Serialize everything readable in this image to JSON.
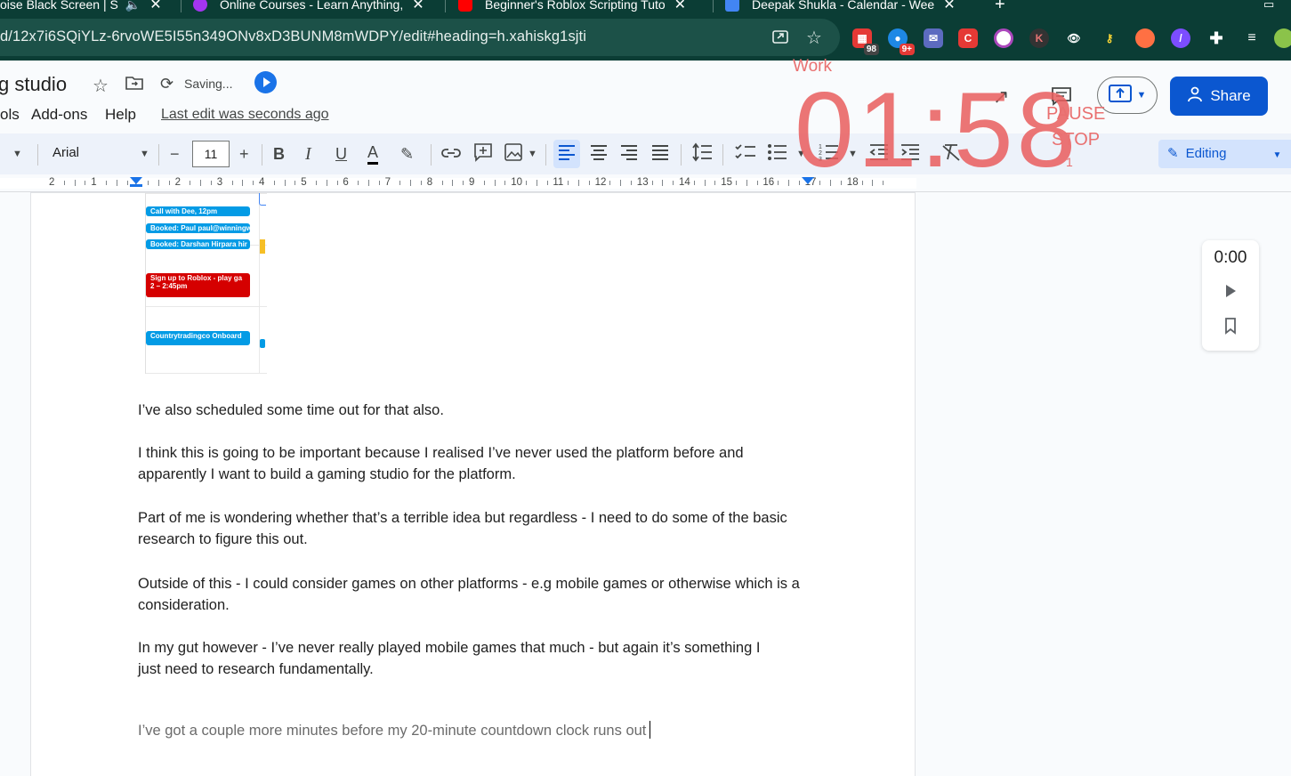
{
  "tabs": [
    {
      "title": "oise Black Screen | S"
    },
    {
      "title": "Online Courses - Learn Anything,"
    },
    {
      "title": "Beginner's Roblox Scripting Tuto"
    },
    {
      "title": "Deepak Shukla - Calendar - Wee"
    }
  ],
  "address": {
    "url": "d/12x7i6SQiYLz-6rvoWE5I55n349ONv8xD3BUNM8mWDPY/edit#heading=h.xahiskg1sjti"
  },
  "extensions": {
    "badge_1": "98",
    "badge_2": "9+"
  },
  "doc": {
    "title": "g studio",
    "saving": "Saving...",
    "menus": [
      "ols",
      "Add-ons",
      "Help"
    ],
    "last_edit": "Last edit was seconds ago",
    "share_label": "Share"
  },
  "toolbar": {
    "font": "Arial",
    "font_size": "11",
    "editing_label": "Editing"
  },
  "ruler": {
    "numbers": [
      "2",
      "1",
      "1",
      "2",
      "3",
      "4",
      "5",
      "6",
      "7",
      "8",
      "9",
      "10",
      "11",
      "12",
      "13",
      "14",
      "15",
      "16",
      "17",
      "18"
    ]
  },
  "calendar_events": [
    {
      "label": "Call with Dee, 12pm",
      "color": "#039be5"
    },
    {
      "label": "Booked: Paul paul@winningw",
      "color": "#039be5"
    },
    {
      "label": "Booked: Darshan Hirpara hir",
      "color": "#039be5"
    },
    {
      "label": "Sign up to Roblox - play ga",
      "sub": "2 – 2:45pm",
      "color": "#d50000"
    },
    {
      "label": "Countrytradingco Onboard",
      "color": "#039be5"
    }
  ],
  "paragraphs": [
    "I’ve also scheduled some time out for that also.",
    "I think this is going to be important because I realised I’ve never used the platform before and apparently I want to build a gaming studio for the platform.",
    "Part of me is wondering whether that’s a terrible idea but regardless - I need to do some of the basic research to figure this out.",
    "Outside of this - I could consider games on other platforms - e.g mobile games or otherwise which is a consideration.",
    "In my gut however - I’ve never really played mobile games that much - but again it’s something I just need to research fundamentally.",
    "I’ve got a couple more minutes before my 20-minute countdown clock runs out"
  ],
  "media": {
    "time": "0:00"
  },
  "timer": {
    "mode": "Work",
    "time": "01:58",
    "pause": "PAUSE",
    "stop": "STOP",
    "count": "1",
    "color": "#e95d5d"
  }
}
